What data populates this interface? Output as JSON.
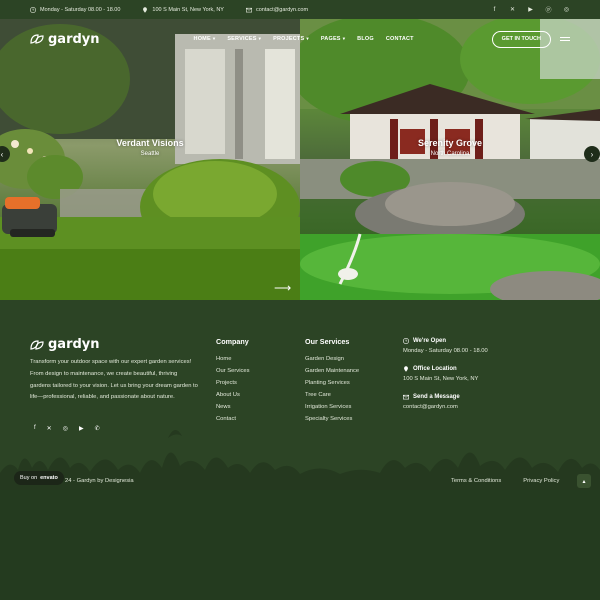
{
  "topbar": {
    "hours": "Monday - Saturday 08.00 - 18.00",
    "address": "100 S Main St, New York, NY",
    "email": "contact@gardyn.com",
    "socials": [
      "facebook-icon",
      "x-icon",
      "youtube-icon",
      "pinterest-icon",
      "instagram-icon"
    ]
  },
  "brand": {
    "name": "gardyn"
  },
  "nav": {
    "items": [
      {
        "label": "HOME",
        "dropdown": true
      },
      {
        "label": "SERVICES",
        "dropdown": true
      },
      {
        "label": "PROJECTS",
        "dropdown": true
      },
      {
        "label": "PAGES",
        "dropdown": true
      },
      {
        "label": "BLOG",
        "dropdown": false
      },
      {
        "label": "CONTACT",
        "dropdown": false
      }
    ],
    "cta": "GET IN TOUCH"
  },
  "slides": [
    {
      "title": "Verdant Visions",
      "location": "Seattle"
    },
    {
      "title": "Serenity Grove",
      "location": "North Carolina"
    }
  ],
  "footer": {
    "description": "Transform your outdoor space with our expert garden services! From design to maintenance, we create beautiful, thriving gardens tailored to your vision. Let us bring your dream garden to life—professional, reliable, and passionate about nature.",
    "company": {
      "title": "Company",
      "links": [
        "Home",
        "Our Services",
        "Projects",
        "About Us",
        "News",
        "Contact"
      ]
    },
    "services": {
      "title": "Our Services",
      "links": [
        "Garden Design",
        "Garden Maintenance",
        "Planting Services",
        "Tree Care",
        "Irrigation Services",
        "Specialty Services"
      ]
    },
    "contact": {
      "open_label": "We're Open",
      "open_value": "Monday - Saturday 08.00 - 18.00",
      "office_label": "Office Location",
      "office_value": "100 S Main St, New York, NY",
      "message_label": "Send a Message",
      "message_value": "contact@gardyn.com"
    },
    "socials": [
      "facebook-icon",
      "x-icon",
      "instagram-icon",
      "youtube-icon",
      "whatsapp-icon"
    ],
    "copyright": "24 - Gardyn by Designesia",
    "legal": [
      "Terms & Conditions",
      "Privacy Policy"
    ],
    "buy_on_prefix": "Buy on",
    "buy_on_brand": "envato"
  },
  "colors": {
    "footer_bg": "#2c4425",
    "footer_bottom": "#243b1f",
    "accent": "#ffffff"
  }
}
